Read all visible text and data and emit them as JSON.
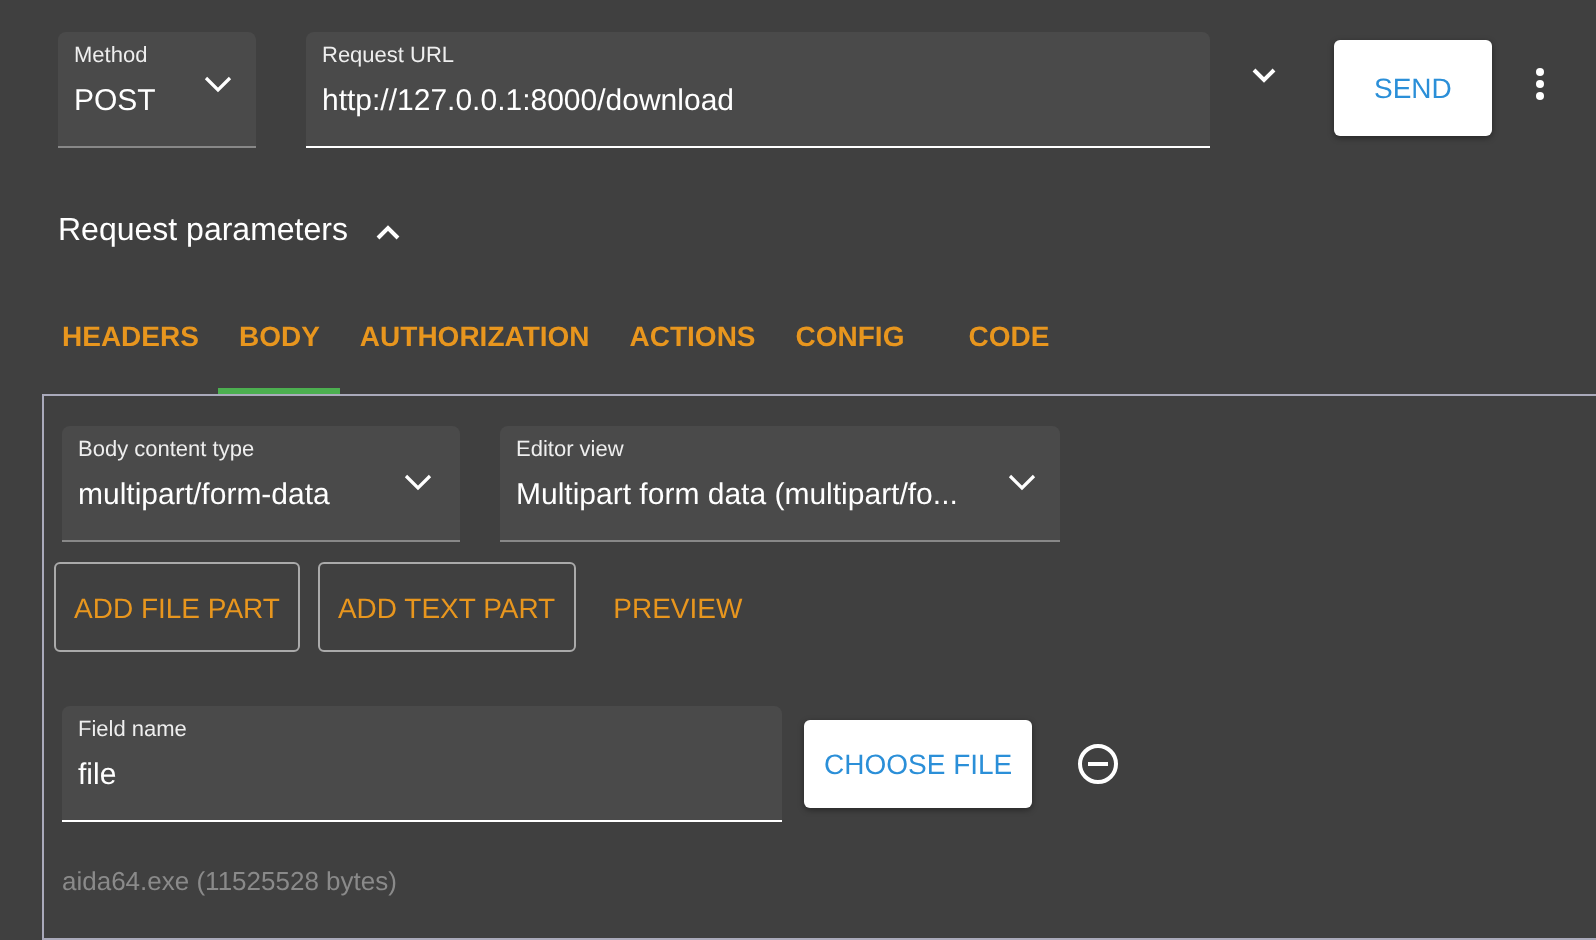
{
  "request": {
    "method": {
      "label": "Method",
      "value": "POST"
    },
    "url": {
      "label": "Request URL",
      "value": "http://127.0.0.1:8000/download"
    },
    "send": "SEND"
  },
  "parameters": {
    "title": "Request parameters",
    "expanded": true
  },
  "tabs": [
    {
      "label": "HEADERS",
      "selected": false
    },
    {
      "label": "BODY",
      "selected": true
    },
    {
      "label": "AUTHORIZATION",
      "selected": false
    },
    {
      "label": "ACTIONS",
      "selected": false
    },
    {
      "label": "CONFIG",
      "selected": false
    },
    {
      "label": "CODE",
      "selected": false
    }
  ],
  "body": {
    "content_type": {
      "label": "Body content type",
      "value": "multipart/form-data"
    },
    "editor_view": {
      "label": "Editor view",
      "value": "Multipart form data (multipart/fo..."
    },
    "actions": [
      {
        "label": "ADD FILE PART",
        "kind": "outlined"
      },
      {
        "label": "ADD TEXT PART",
        "kind": "outlined"
      },
      {
        "label": "PREVIEW",
        "kind": "text"
      }
    ],
    "parts": [
      {
        "field_label": "Field name",
        "field_value": "file",
        "choose": "CHOOSE FILE",
        "file_info": "aida64.exe (11525528 bytes)"
      }
    ]
  }
}
